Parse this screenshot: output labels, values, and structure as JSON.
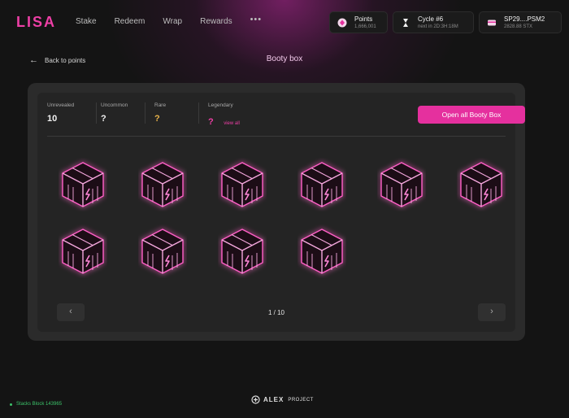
{
  "header": {
    "logo": "LISA",
    "nav": [
      "Stake",
      "Redeem",
      "Wrap",
      "Rewards"
    ],
    "more": "•••",
    "points": {
      "label": "Points",
      "value": "1,666,001"
    },
    "cycle": {
      "label": "Cycle #6",
      "sub": "next in 2D:3H:18M"
    },
    "wallet": {
      "address": "SP29....PSM2",
      "balance": "2828.88 STX"
    }
  },
  "back_label": "Back to points",
  "page_title": "Booty box",
  "stats": {
    "unrevealed": {
      "label": "Unrevealed",
      "value": "10"
    },
    "uncommon": {
      "label": "Uncommon",
      "value": "?"
    },
    "rare": {
      "label": "Rare",
      "value": "?"
    },
    "legendary": {
      "label": "Legendary",
      "value": "?",
      "link": "view all"
    }
  },
  "open_all_label": "Open all Booty Box",
  "box_count": 10,
  "pagination": {
    "prev": "‹",
    "next": "›",
    "info": "1 / 10"
  },
  "footer": {
    "status": "Stacks Block 143965",
    "brand": "ALEX",
    "project": "PROJECT"
  },
  "colors": {
    "accent": "#e5309e",
    "rare": "#e8b34a",
    "status": "#3cc36a"
  }
}
